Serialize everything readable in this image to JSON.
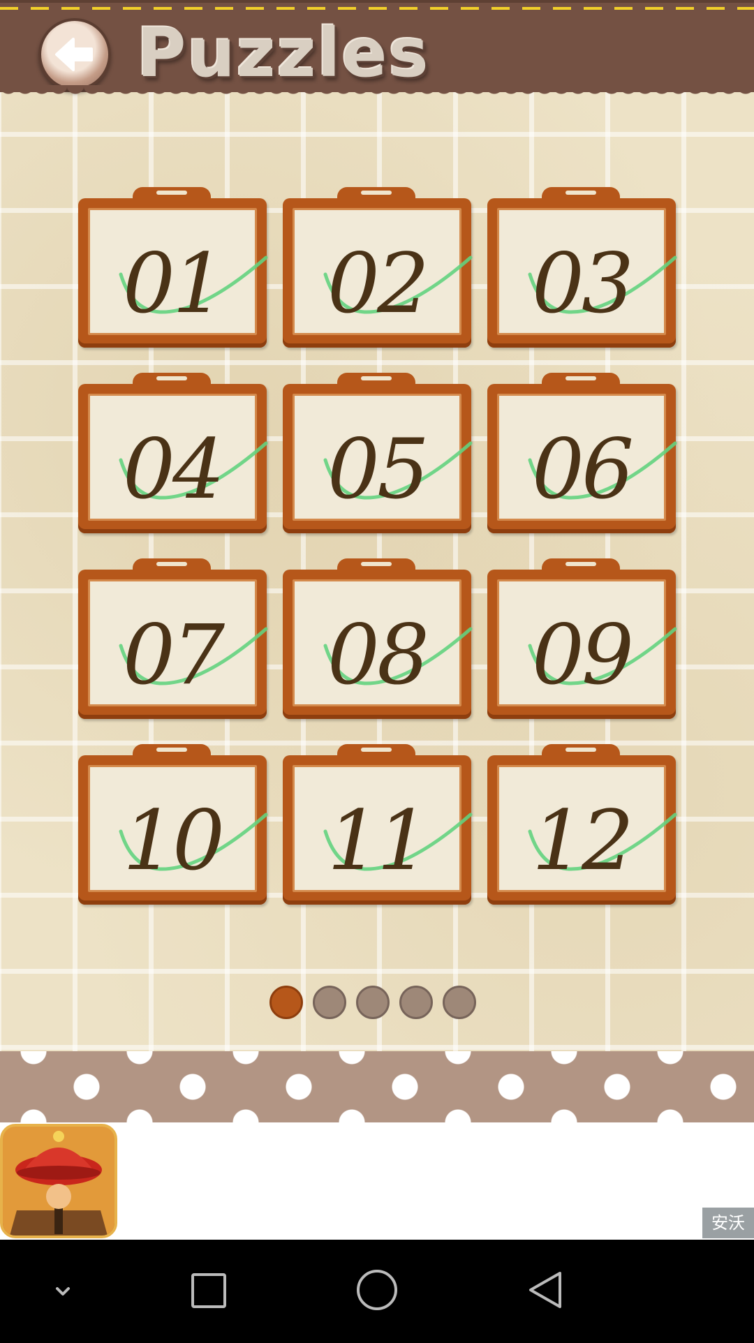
{
  "header": {
    "title": "Puzzles",
    "back_icon": "back-arrow-icon"
  },
  "levels": [
    {
      "label": "01",
      "completed": true
    },
    {
      "label": "02",
      "completed": true
    },
    {
      "label": "03",
      "completed": true
    },
    {
      "label": "04",
      "completed": true
    },
    {
      "label": "05",
      "completed": true
    },
    {
      "label": "06",
      "completed": true
    },
    {
      "label": "07",
      "completed": true
    },
    {
      "label": "08",
      "completed": true
    },
    {
      "label": "09",
      "completed": true
    },
    {
      "label": "10",
      "completed": true
    },
    {
      "label": "11",
      "completed": true
    },
    {
      "label": "12",
      "completed": true
    }
  ],
  "pagination": {
    "pages": 5,
    "current": 1
  },
  "ad": {
    "label": "安沃"
  },
  "navbar": {
    "icons": [
      "chevron-down-icon",
      "recents-square-icon",
      "home-circle-icon",
      "back-triangle-icon"
    ]
  },
  "colors": {
    "header": "#745143",
    "frame": "#b6571a",
    "check": "#5fd07a",
    "digits": "#4a3216"
  }
}
